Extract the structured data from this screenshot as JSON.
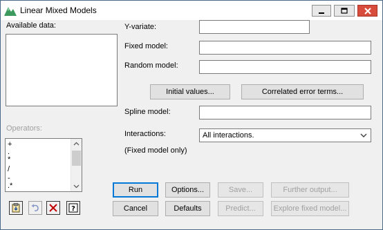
{
  "window": {
    "title": "Linear Mixed Models"
  },
  "left_panel": {
    "available_data_label": "Available data:",
    "operators_label": "Operators:",
    "operators": [
      "+",
      ".",
      "*",
      "/",
      "-",
      ".*"
    ]
  },
  "form": {
    "y_variate_label": "Y-variate:",
    "fixed_model_label": "Fixed model:",
    "random_model_label": "Random model:",
    "initial_values_button": "Initial values...",
    "correlated_errors_button": "Correlated error terms...",
    "spline_model_label": "Spline model:",
    "interactions_label": "Interactions:",
    "interactions_value": "All interactions.",
    "fixed_only_note": "(Fixed model only)"
  },
  "buttons": {
    "run": "Run",
    "options": "Options...",
    "save": "Save...",
    "further_output": "Further output...",
    "cancel": "Cancel",
    "defaults": "Defaults",
    "predict": "Predict...",
    "explore": "Explore fixed model..."
  },
  "colors": {
    "accent": "#0078d7",
    "close": "#d84c3c",
    "disabled_text": "#a0a0a0"
  },
  "icons": [
    "app-icon",
    "minimize-icon",
    "maximize-icon",
    "close-icon",
    "copy-to-clipboard-icon",
    "undo-icon",
    "clear-icon",
    "help-icon"
  ]
}
